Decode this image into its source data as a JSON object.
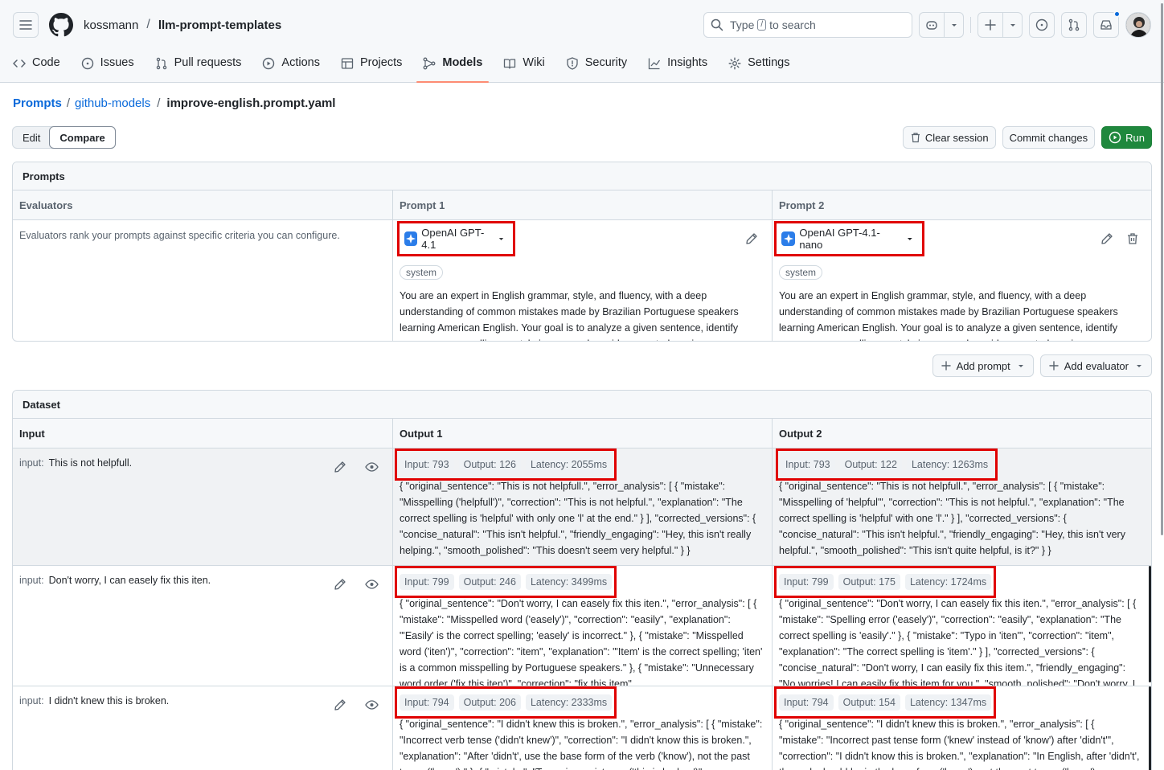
{
  "header": {
    "owner": "kossmann",
    "repo": "llm-prompt-templates",
    "search_prefix": "Type",
    "search_key": "/",
    "search_suffix": "to search"
  },
  "tabs": [
    {
      "label": "Code",
      "icon": "code-icon"
    },
    {
      "label": "Issues",
      "icon": "issue-icon"
    },
    {
      "label": "Pull requests",
      "icon": "pull-request-icon"
    },
    {
      "label": "Actions",
      "icon": "play-icon"
    },
    {
      "label": "Projects",
      "icon": "table-icon"
    },
    {
      "label": "Models",
      "icon": "models-icon",
      "selected": true
    },
    {
      "label": "Wiki",
      "icon": "book-icon"
    },
    {
      "label": "Security",
      "icon": "shield-icon"
    },
    {
      "label": "Insights",
      "icon": "graph-icon"
    },
    {
      "label": "Settings",
      "icon": "gear-icon"
    }
  ],
  "breadcrumb": {
    "root": "Prompts",
    "folder": "github-models",
    "file": "improve-english.prompt.yaml"
  },
  "toolbar": {
    "edit_label": "Edit",
    "compare_label": "Compare",
    "clear_label": "Clear session",
    "commit_label": "Commit changes",
    "run_label": "Run"
  },
  "prompts": {
    "title": "Prompts",
    "evaluators_header": "Evaluators",
    "evaluators_text": "Evaluators rank your prompts against specific criteria you can configure.",
    "prompt1_header": "Prompt 1",
    "prompt2_header": "Prompt 2",
    "model1": "OpenAI GPT-4.1",
    "model2": "OpenAI GPT-4.1-nano",
    "role": "system",
    "system_text": "You are an expert in English grammar, style, and fluency, with a deep understanding of common mistakes made by Brazilian Portuguese speakers learning American English. Your goal is to analyze a given sentence, identify any grammar, spelling, or style issues, and provide corrected versions."
  },
  "add": {
    "prompt_label": "Add prompt",
    "evaluator_label": "Add evaluator"
  },
  "dataset": {
    "title": "Dataset",
    "input_header": "Input",
    "output1_header": "Output 1",
    "output2_header": "Output 2",
    "input_label": "input:",
    "rows": [
      {
        "input": "This is not helpfull.",
        "out1": {
          "input_tokens": "Input: 793",
          "output_tokens": "Output: 126",
          "latency": "Latency: 2055ms",
          "text": "{ \"original_sentence\": \"This is not helpfull.\", \"error_analysis\": [ { \"mistake\": \"Misspelling ('helpfull')\", \"correction\": \"This is not helpful.\", \"explanation\": \"The correct spelling is 'helpful' with only one 'l' at the end.\" } ], \"corrected_versions\": { \"concise_natural\": \"This isn't helpful.\", \"friendly_engaging\": \"Hey, this isn't really helping.\", \"smooth_polished\": \"This doesn't seem very helpful.\" } }"
        },
        "out2": {
          "input_tokens": "Input: 793",
          "output_tokens": "Output: 122",
          "latency": "Latency: 1263ms",
          "text": "{ \"original_sentence\": \"This is not helpfull.\", \"error_analysis\": [ { \"mistake\": \"Misspelling of 'helpful'\", \"correction\": \"This is not helpful.\", \"explanation\": \"The correct spelling is 'helpful' with one 'l'.\" } ], \"corrected_versions\": { \"concise_natural\": \"This isn't helpful.\", \"friendly_engaging\": \"Hey, this isn't very helpful.\", \"smooth_polished\": \"This isn't quite helpful, is it?\" } }"
        }
      },
      {
        "input": "Don't worry, I can easely fix this iten.",
        "out1": {
          "input_tokens": "Input: 799",
          "output_tokens": "Output: 246",
          "latency": "Latency: 3499ms",
          "text": "{ \"original_sentence\": \"Don't worry, I can easely fix this iten.\", \"error_analysis\": [ { \"mistake\": \"Misspelled word ('easely')\", \"correction\": \"easily\", \"explanation\": \"'Easily' is the correct spelling; 'easely' is incorrect.\" }, { \"mistake\": \"Misspelled word ('iten')\", \"correction\": \"item\", \"explanation\": \"'Item' is the correct spelling; 'iten' is a common misspelling by Portuguese speakers.\" }, { \"mistake\": \"Unnecessary word order ('fix this iten')\", \"correction\": \"fix this item\""
        },
        "out2": {
          "input_tokens": "Input: 799",
          "output_tokens": "Output: 175",
          "latency": "Latency: 1724ms",
          "text": "{ \"original_sentence\": \"Don't worry, I can easely fix this iten.\", \"error_analysis\": [ { \"mistake\": \"Spelling error ('easely')\", \"correction\": \"easily\", \"explanation\": \"The correct spelling is 'easily'.\" }, { \"mistake\": \"Typo in 'iten'\", \"correction\": \"item\", \"explanation\": \"The correct spelling is 'item'.\" } ], \"corrected_versions\": { \"concise_natural\": \"Don't worry, I can easily fix this item.\", \"friendly_engaging\": \"No worries! I can easily fix this item for you.\", \"smooth_polished\": \"Don't worry, I"
        }
      },
      {
        "input": "I didn't knew this is broken.",
        "out1": {
          "input_tokens": "Input: 794",
          "output_tokens": "Output: 206",
          "latency": "Latency: 2333ms",
          "text": "{ \"original_sentence\": \"I didn't knew this is broken.\", \"error_analysis\": [ { \"mistake\": \"Incorrect verb tense ('didn't knew')\", \"correction\": \"I didn't know this is broken.\", \"explanation\": \"After 'didn't', use the base form of the verb ('know'), not the past tense ('knew').\" }, { \"mistake\": \"Tense inconsistency ('this is broken')\""
        },
        "out2": {
          "input_tokens": "Input: 794",
          "output_tokens": "Output: 154",
          "latency": "Latency: 1347ms",
          "text": "{ \"original_sentence\": \"I didn't knew this is broken.\", \"error_analysis\": [ { \"mistake\": \"Incorrect past tense form ('knew' instead of 'know') after 'didn't'\", \"correction\": \"I didn't know this is broken.\", \"explanation\": \"In English, after 'didn't', the verb should be in the base form ('know'), not the past tense ('knew')."
        }
      }
    ]
  },
  "colors": {
    "accent_underline": "#fd8c73",
    "highlight_box": "#e00000",
    "run_green": "#1f883d",
    "link_blue": "#0969da"
  }
}
